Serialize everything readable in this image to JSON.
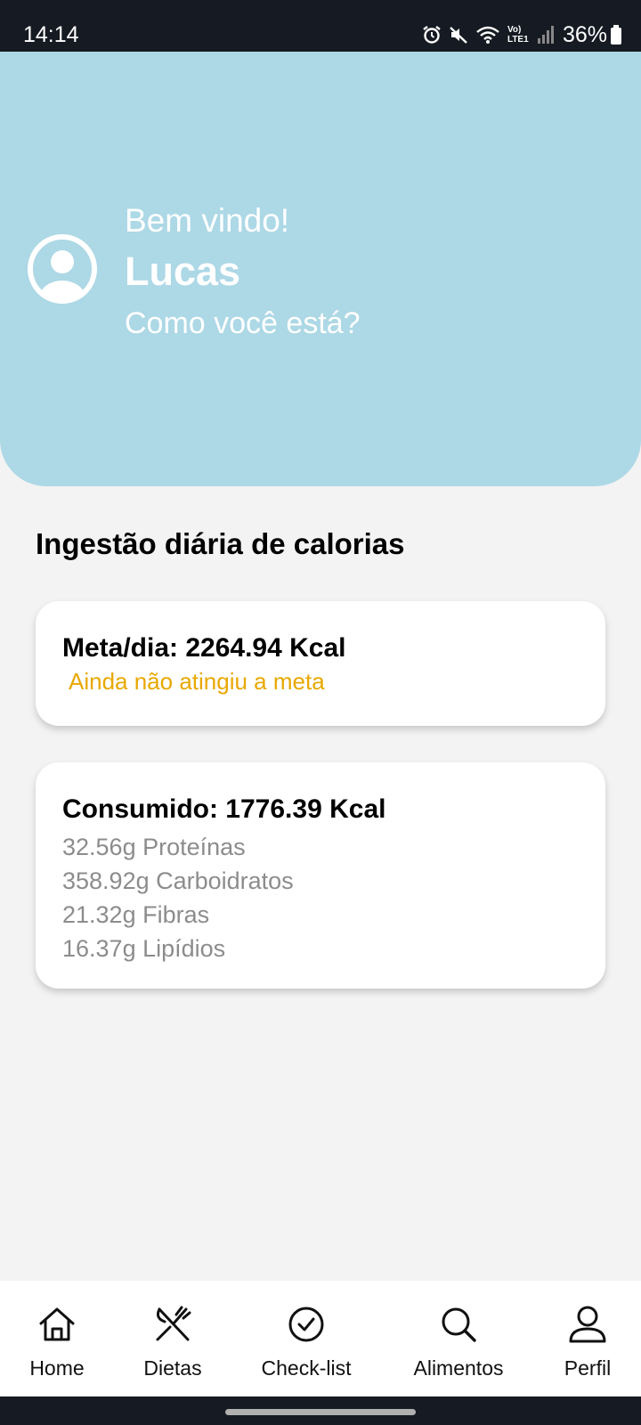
{
  "status_bar": {
    "time": "14:14",
    "network_label": "Vo) LTE1",
    "battery": "36%",
    "icons": [
      "alarm-icon",
      "mute-icon",
      "wifi-icon",
      "signal-icon",
      "battery-icon"
    ]
  },
  "header": {
    "greeting": "Bem vindo!",
    "username": "Lucas",
    "subtitle": "Como você está?",
    "avatar_icon": "user-circle-icon",
    "background_color": "#add8e6"
  },
  "section": {
    "title": "Ingestão diária de calorias"
  },
  "goal_card": {
    "heading": "Meta/dia: 2264.94 Kcal",
    "status": "Ainda não atingiu a meta",
    "status_color": "#e8a800"
  },
  "consumed_card": {
    "heading": "Consumido: 1776.39 Kcal",
    "macros": [
      "32.56g Proteínas",
      "358.92g Carboidratos",
      "21.32g Fibras",
      "16.37g Lipídios"
    ]
  },
  "bottom_nav": {
    "items": [
      {
        "label": "Home",
        "icon": "home-icon"
      },
      {
        "label": "Dietas",
        "icon": "fork-knife-icon"
      },
      {
        "label": "Check-list",
        "icon": "check-circle-icon"
      },
      {
        "label": "Alimentos",
        "icon": "search-icon"
      },
      {
        "label": "Perfil",
        "icon": "user-icon"
      }
    ]
  }
}
